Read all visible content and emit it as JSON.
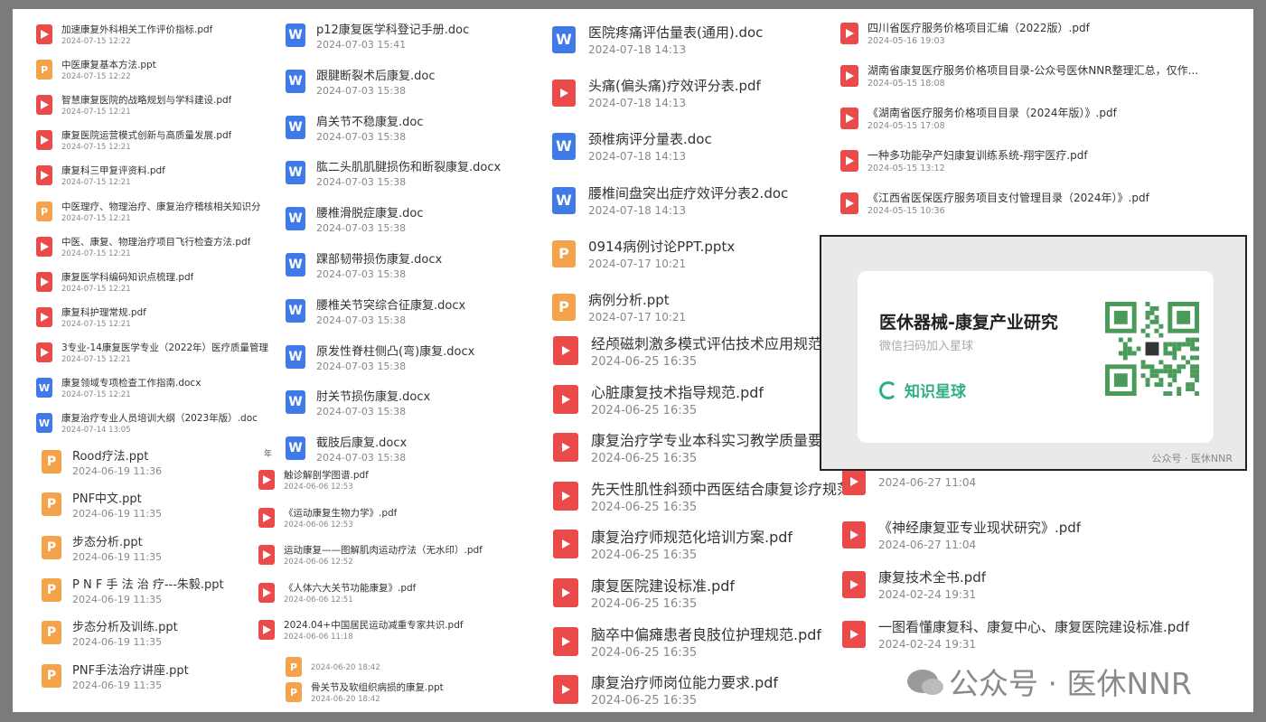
{
  "col1": [
    {
      "type": "pdf",
      "name": "加速康复外科相关工作评价指标.pdf",
      "date": "2024-07-15 12:22"
    },
    {
      "type": "ppt",
      "name": "中医康复基本方法.ppt",
      "date": "2024-07-15 12:22"
    },
    {
      "type": "pdf",
      "name": "智慧康复医院的战略规划与学科建设.pdf",
      "date": "2024-07-15 12:21"
    },
    {
      "type": "pdf",
      "name": "康复医院运营模式创新与高质量发展.pdf",
      "date": "2024-07-15 12:21"
    },
    {
      "type": "pdf",
      "name": "康复科三甲复评资料.pdf",
      "date": "2024-07-15 12:21"
    },
    {
      "type": "ppt",
      "name": "中医理疗、物理治疗、康复治疗稽核相关知识分",
      "date": "2024-07-15 12:21"
    },
    {
      "type": "pdf",
      "name": "中医、康复、物理治疗项目飞行检查方法.pdf",
      "date": "2024-07-15 12:21"
    },
    {
      "type": "pdf",
      "name": "康复医学科编码知识点梳理.pdf",
      "date": "2024-07-15 12:21"
    },
    {
      "type": "pdf",
      "name": "康复科护理常规.pdf",
      "date": "2024-07-15 12:21"
    },
    {
      "type": "pdf",
      "name": "3专业-14康复医学专业（2022年）医疗质量管理",
      "date": "2024-07-15 12:21"
    },
    {
      "type": "doc",
      "name": "康复领域专项检查工作指南.docx",
      "date": "2024-07-15 12:21"
    },
    {
      "type": "doc",
      "name": "康复治疗专业人员培训大纲（2023年版）.doc",
      "date": "2024-07-14 13:05"
    }
  ],
  "col1b": [
    {
      "type": "ppt",
      "name": "Rood疗法.ppt",
      "date": "2024-06-19 11:36"
    },
    {
      "type": "ppt",
      "name": "PNF中文.ppt",
      "date": "2024-06-19 11:35"
    },
    {
      "type": "ppt",
      "name": "步态分析.ppt",
      "date": "2024-06-19 11:35"
    },
    {
      "type": "ppt",
      "name": "P N F 手 法 治 疗---朱毅.ppt",
      "date": "2024-06-19 11:35"
    },
    {
      "type": "ppt",
      "name": "步态分析及训练.ppt",
      "date": "2024-06-19 11:35"
    },
    {
      "type": "ppt",
      "name": "PNF手法治疗讲座.ppt",
      "date": "2024-06-19 11:35"
    }
  ],
  "col2": [
    {
      "type": "doc",
      "name": "p12康复医学科登记手册.doc",
      "date": "2024-07-03 15:41"
    },
    {
      "type": "doc",
      "name": "跟腱断裂术后康复.doc",
      "date": "2024-07-03 15:38"
    },
    {
      "type": "doc",
      "name": "肩关节不稳康复.doc",
      "date": "2024-07-03 15:38"
    },
    {
      "type": "doc",
      "name": "肱二头肌肌腱损伤和断裂康复.docx",
      "date": "2024-07-03 15:38"
    },
    {
      "type": "doc",
      "name": "腰椎滑脱症康复.doc",
      "date": "2024-07-03 15:38"
    },
    {
      "type": "doc",
      "name": "踝部韧带损伤康复.docx",
      "date": "2024-07-03 15:38"
    },
    {
      "type": "doc",
      "name": "腰椎关节突综合征康复.docx",
      "date": "2024-07-03 15:38"
    },
    {
      "type": "doc",
      "name": "原发性脊柱侧凸(弯)康复.docx",
      "date": "2024-07-03 15:38"
    },
    {
      "type": "doc",
      "name": "肘关节损伤康复.docx",
      "date": "2024-07-03 15:38"
    },
    {
      "type": "doc",
      "name": "截肢后康复.docx",
      "date": "2024-07-03 15:38"
    }
  ],
  "col2b": [
    {
      "type": "pdf",
      "name": "触诊解剖学图谱.pdf",
      "date": "2024-06-06 12:53"
    },
    {
      "type": "pdf",
      "name": "《运动康复生物力学》.pdf",
      "date": "2024-06-06 12:53"
    },
    {
      "type": "pdf",
      "name": "运动康复——图解肌肉运动疗法（无水印）.pdf",
      "date": "2024-06-06 12:52"
    },
    {
      "type": "pdf",
      "name": "《人体六大关节功能康复》.pdf",
      "date": "2024-06-06 12:51"
    },
    {
      "type": "pdf",
      "name": "2024.04+中国居民运动减重专家共识.pdf",
      "date": "2024-06-06 11:18"
    }
  ],
  "col2c": [
    {
      "type": "ppt",
      "name": "",
      "date": "2024-06-20 18:42"
    },
    {
      "type": "ppt",
      "name": "骨关节及软组织病损的康复.ppt",
      "date": "2024-06-20 18:42"
    }
  ],
  "col3": [
    {
      "type": "doc",
      "name": "医院疼痛评估量表(通用).doc",
      "date": "2024-07-18 14:13"
    },
    {
      "type": "pdf",
      "name": "头痛(偏头痛)疗效评分表.pdf",
      "date": "2024-07-18 14:13"
    },
    {
      "type": "doc",
      "name": "颈椎病评分量表.doc",
      "date": "2024-07-18 14:13"
    },
    {
      "type": "doc",
      "name": "腰椎间盘突出症疗效评分表2.doc",
      "date": "2024-07-18 14:13"
    },
    {
      "type": "ppt",
      "name": "0914病例讨论PPT.pptx",
      "date": "2024-07-17 10:21"
    },
    {
      "type": "ppt",
      "name": "病例分析.ppt",
      "date": "2024-07-17 10:21"
    }
  ],
  "col3b": [
    {
      "type": "pdf",
      "name": "经颅磁刺激多模式评估技术应用规范.pdf",
      "date": "2024-06-25 16:35"
    },
    {
      "type": "pdf",
      "name": "心脏康复技术指导规范.pdf",
      "date": "2024-06-25 16:35"
    },
    {
      "type": "pdf",
      "name": "康复治疗学专业本科实习教学质量要求",
      "date": "2024-06-25 16:35"
    },
    {
      "type": "pdf",
      "name": "先天性肌性斜颈中西医结合康复诊疗规范",
      "date": "2024-06-25 16:35"
    },
    {
      "type": "pdf",
      "name": "康复治疗师规范化培训方案.pdf",
      "date": "2024-06-25 16:35"
    },
    {
      "type": "pdf",
      "name": "康复医院建设标准.pdf",
      "date": "2024-06-25 16:35"
    },
    {
      "type": "pdf",
      "name": "脑卒中偏瘫患者良肢位护理规范.pdf",
      "date": "2024-06-25 16:35"
    },
    {
      "type": "pdf",
      "name": "康复治疗师岗位能力要求.pdf",
      "date": "2024-06-25 16:35"
    }
  ],
  "col4": [
    {
      "type": "pdf",
      "name": "四川省医疗服务价格项目汇编（2022版）.pdf",
      "date": "2024-05-16 19:03"
    },
    {
      "type": "pdf",
      "name": "湖南省康复医疗服务价格项目目录-公众号医休NNR整理汇总，仅作...",
      "date": "2024-05-15 18:08"
    },
    {
      "type": "pdf",
      "name": "《湖南省医疗服务价格项目目录（2024年版）》.pdf",
      "date": "2024-05-15 17:08"
    },
    {
      "type": "pdf",
      "name": "一种多功能孕产妇康复训练系统-翔宇医疗.pdf",
      "date": "2024-05-15 13:12"
    },
    {
      "type": "pdf",
      "name": "《江西省医保医疗服务项目支付管理目录（2024年）》.pdf",
      "date": "2024-05-15 10:36"
    }
  ],
  "col4b": [
    {
      "type": "pdf",
      "name": "",
      "date": "2024-06-27 11:04"
    },
    {
      "type": "pdf",
      "name": "《神经康复亚专业现状研究》.pdf",
      "date": "2024-06-27 11:04"
    },
    {
      "type": "pdf",
      "name": "康复技术全书.pdf",
      "date": "2024-02-24 19:31"
    },
    {
      "type": "pdf",
      "name": "一图看懂康复科、康复中心、康复医院建设标准.pdf",
      "date": "2024-02-24 19:31"
    }
  ],
  "stray": "年",
  "qr": {
    "title": "医休器械-康复产业研究",
    "subtitle": "微信扫码加入星球",
    "brand": "知识星球",
    "watermark": "公众号 · 医休NNR"
  },
  "watermark": "公众号 · 医休NNR"
}
